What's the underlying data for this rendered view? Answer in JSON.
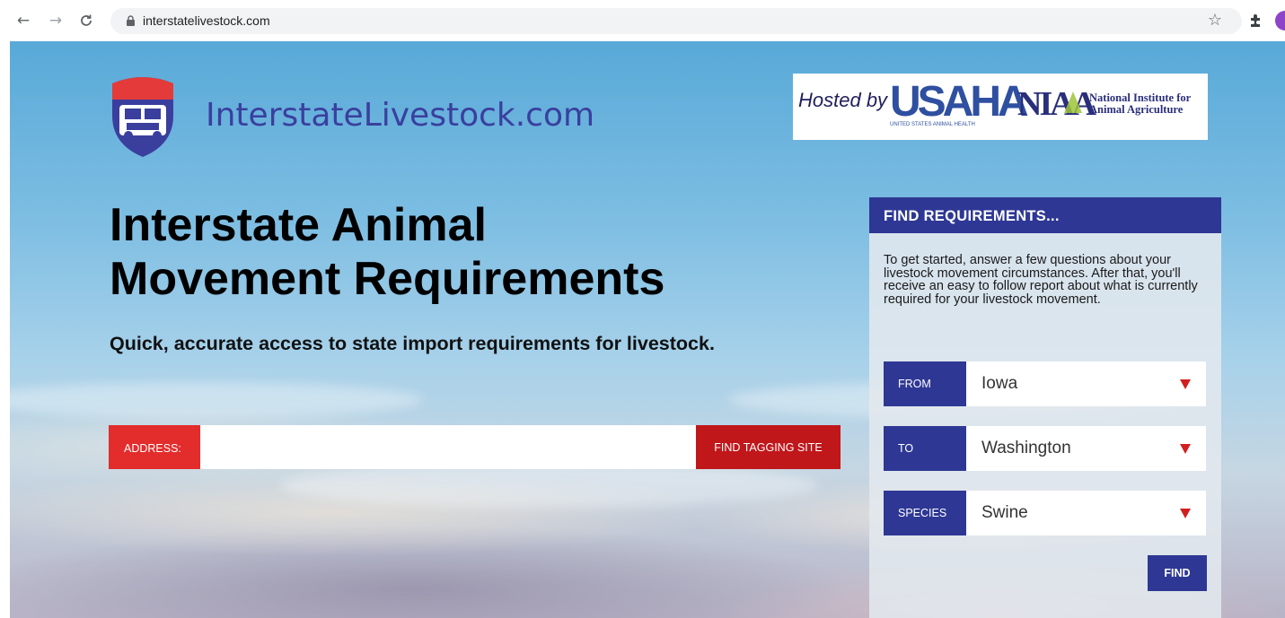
{
  "browser": {
    "url": "interstatelivestock.com",
    "back_icon": "←",
    "forward_icon": "→",
    "reload_icon": "C",
    "star_icon": "☆"
  },
  "header": {
    "logo_text": "InterstateLivestock.com",
    "hosted_by": "Hosted by",
    "usaha_text": "USAHA",
    "usaha_subtitle": "UNITED STATES ANIMAL HEALTH",
    "niaa_text": "NIAA",
    "niaa_full_line1": "National Institute for",
    "niaa_full_line2": "Animal Agriculture"
  },
  "hero": {
    "title_line1": "Interstate Animal",
    "title_line2": "Movement Requirements",
    "subtitle": "Quick, accurate access to state import requirements for livestock."
  },
  "address_search": {
    "label": "ADDRESS:",
    "value": "",
    "button_label": "FIND TAGGING SITE"
  },
  "requirements_panel": {
    "title": "FIND REQUIREMENTS...",
    "description": "To get started, answer a few questions about your livestock movement circumstances. After that, you'll receive an easy to follow report about what is currently required for your livestock movement.",
    "from_label": "FROM",
    "from_value": "Iowa",
    "to_label": "TO",
    "to_value": "Washington",
    "species_label": "SPECIES",
    "species_value": "Swine",
    "find_button": "FIND"
  },
  "colors": {
    "brand_blue": "#2e3894",
    "address_red": "#e32c2c",
    "tagging_button_red": "#c0171b",
    "select_arrow_red": "#d11f1f"
  }
}
